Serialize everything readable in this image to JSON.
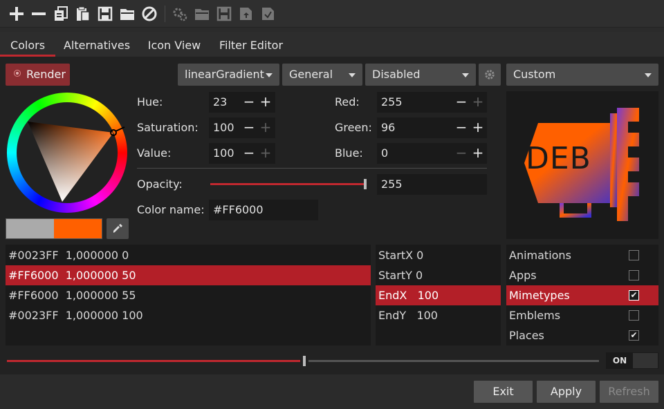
{
  "toolbar": {
    "icons": [
      "add-icon",
      "remove-icon",
      "copy-icon",
      "paste-icon",
      "save-icon",
      "open-folder-icon",
      "clear-icon",
      "settings-gears-icon",
      "folder-icon",
      "save-disabled-icon",
      "export-icon",
      "import-icon"
    ]
  },
  "tabs": [
    "Colors",
    "Alternatives",
    "Icon View",
    "Filter Editor"
  ],
  "render_button": "Render",
  "combos": {
    "gradient_type": "linearGradient",
    "category": "General",
    "state": "Disabled",
    "theme": "Custom"
  },
  "hsv": {
    "hue_label": "Hue:",
    "hue": "23",
    "saturation_label": "Saturation:",
    "saturation": "100",
    "value_label": "Value:",
    "value": "100"
  },
  "rgb": {
    "red_label": "Red:",
    "red": "255",
    "green_label": "Green:",
    "green": "96",
    "blue_label": "Blue:",
    "blue": "0"
  },
  "opacity": {
    "label": "Opacity:",
    "value": "255",
    "level": 1.0
  },
  "color_name": {
    "label": "Color name:",
    "value": "#FF6000"
  },
  "preview": {
    "text": "DEB",
    "gradient_from": "#0023FF",
    "gradient_to": "#FF6000"
  },
  "swatches": {
    "previous": "#AAAAAA",
    "current": "#FF6000"
  },
  "stops": [
    {
      "text": "#0023FF  1,000000 0",
      "selected": false
    },
    {
      "text": "#FF6000  1,000000 50",
      "selected": true
    },
    {
      "text": "#FF6000  1,000000 55",
      "selected": false
    },
    {
      "text": "#0023FF  1,000000 100",
      "selected": false
    }
  ],
  "coords": [
    {
      "text": "StartX 0",
      "selected": false
    },
    {
      "text": "StartY 0",
      "selected": false
    },
    {
      "text": "EndX   100",
      "selected": true
    },
    {
      "text": "EndY   100",
      "selected": false
    }
  ],
  "categories": [
    {
      "label": "Animations",
      "checked": false,
      "selected": false
    },
    {
      "label": "Apps",
      "checked": false,
      "selected": false
    },
    {
      "label": "Mimetypes",
      "checked": true,
      "selected": true
    },
    {
      "label": "Emblems",
      "checked": false,
      "selected": false
    },
    {
      "label": "Places",
      "checked": true,
      "selected": false
    }
  ],
  "stop_slider": {
    "level": 0.5
  },
  "toggle": {
    "label": "ON",
    "state": true
  },
  "buttons": {
    "exit": "Exit",
    "apply": "Apply",
    "refresh": "Refresh"
  },
  "colors": {
    "accent": "#C0282F",
    "selection": "#B31F28"
  }
}
